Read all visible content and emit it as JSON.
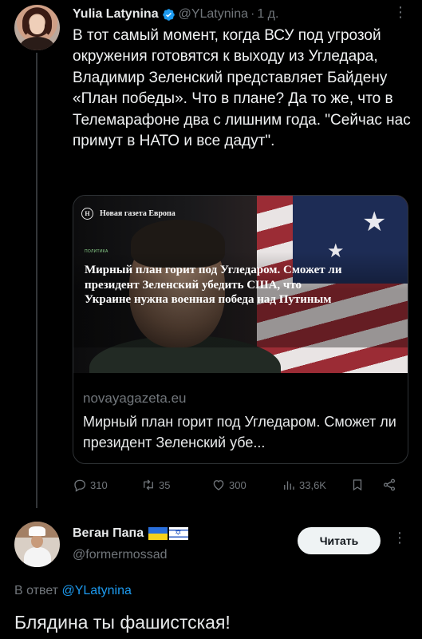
{
  "tweet": {
    "author_name": "Yulia Latynina",
    "author_handle": "@YLatynina",
    "separator": "·",
    "time": "1 д.",
    "text": "В тот самый момент, когда ВСУ под угрозой окружения готовятся к выходу из Угледара, Владимир Зеленский представляет Байдену «План победы». Что в плане? Да то же, что в Телемарафоне два с лишним года. \"Сейчас нас примут в НАТО и все дадут\".",
    "card": {
      "logo_text": "Новая газета Европа",
      "tag": "ПОЛИТИКА",
      "headline": "Мирный план горит под Угледаром. Сможет ли президент Зеленский убедить США, что Украине нужна военная победа над Путиным",
      "domain": "novayagazeta.eu",
      "title": "Мирный план горит под Угледаром. Сможет ли президент Зеленский убе..."
    },
    "stats": {
      "replies": "310",
      "retweets": "35",
      "likes": "300",
      "views": "33,6K"
    },
    "icons": [
      "verified-badge-icon",
      "more-icon",
      "reply-icon",
      "retweet-icon",
      "like-icon",
      "views-icon",
      "bookmark-icon",
      "share-icon"
    ]
  },
  "reply": {
    "author_name": "Веган Папа",
    "author_handle": "@formermossad",
    "follow_label": "Читать",
    "replying_prefix": "В ответ",
    "replying_handle": "@YLatynina",
    "text": "Блядина ты фашистская!"
  },
  "colors": {
    "background": "#000000",
    "text": "#e7e9ea",
    "muted": "#71767b",
    "accent": "#1d9bf0",
    "follow_bg": "#eff3f4"
  }
}
